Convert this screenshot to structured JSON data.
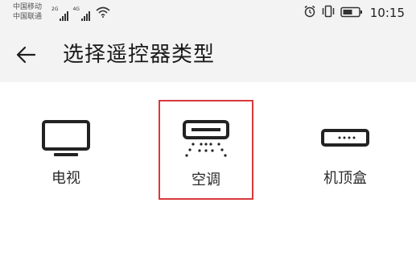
{
  "status_bar": {
    "carrier_1": "中国移动",
    "carrier_2": "中国联通",
    "network_1": "2G",
    "network_2": "4G",
    "time": "10:15",
    "icons": [
      "signal-icon",
      "wifi-icon",
      "alarm-icon",
      "vibrate-icon",
      "battery-icon"
    ]
  },
  "header": {
    "title": "选择遥控器类型"
  },
  "device_types": [
    {
      "label": "电视",
      "icon": "tv-icon"
    },
    {
      "label": "空调",
      "icon": "air-conditioner-icon"
    },
    {
      "label": "机顶盒",
      "icon": "set-top-box-icon"
    }
  ],
  "colors": {
    "header_background": "#f3f3f3",
    "selection_border": "#d9393b",
    "icon": "#222222"
  }
}
